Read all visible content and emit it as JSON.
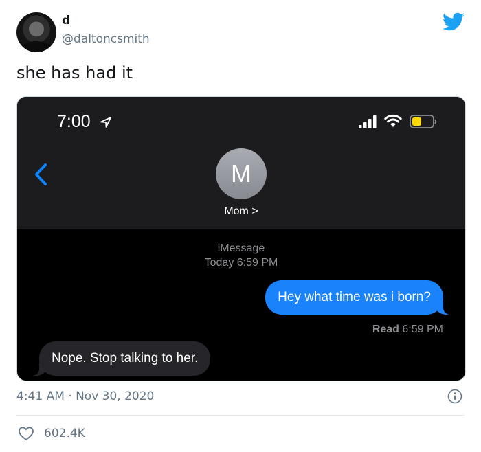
{
  "tweet": {
    "display_name": "d",
    "handle": "@daltoncsmith",
    "text": "she has had it",
    "timestamp": "4:41 AM · Nov 30, 2020",
    "likes": "602.4K"
  },
  "phone": {
    "status_time": "7:00",
    "contact_initial": "M",
    "contact_name": "Mom >",
    "service_label": "iMessage",
    "service_time": "Today 6:59 PM",
    "messages": [
      {
        "direction": "sent",
        "text": "Hey what time was i born?"
      },
      {
        "direction": "received",
        "text": "Nope. Stop talking to her."
      }
    ],
    "read_label": "Read",
    "read_time": "6:59 PM"
  },
  "icons": {
    "brand": "twitter-bird-icon",
    "info": "info-icon",
    "like": "heart-icon",
    "back": "chevron-left-icon",
    "location": "location-arrow-icon",
    "signal": "signal-bars-icon",
    "wifi": "wifi-icon",
    "battery": "battery-icon"
  },
  "colors": {
    "twitter_blue": "#1da1f2",
    "imessage_blue": "#1a82fb",
    "received_bubble": "#26252a",
    "ios_back_blue": "#0a84ff",
    "battery_low_yellow": "#ffd60a",
    "secondary_text": "#657786"
  }
}
